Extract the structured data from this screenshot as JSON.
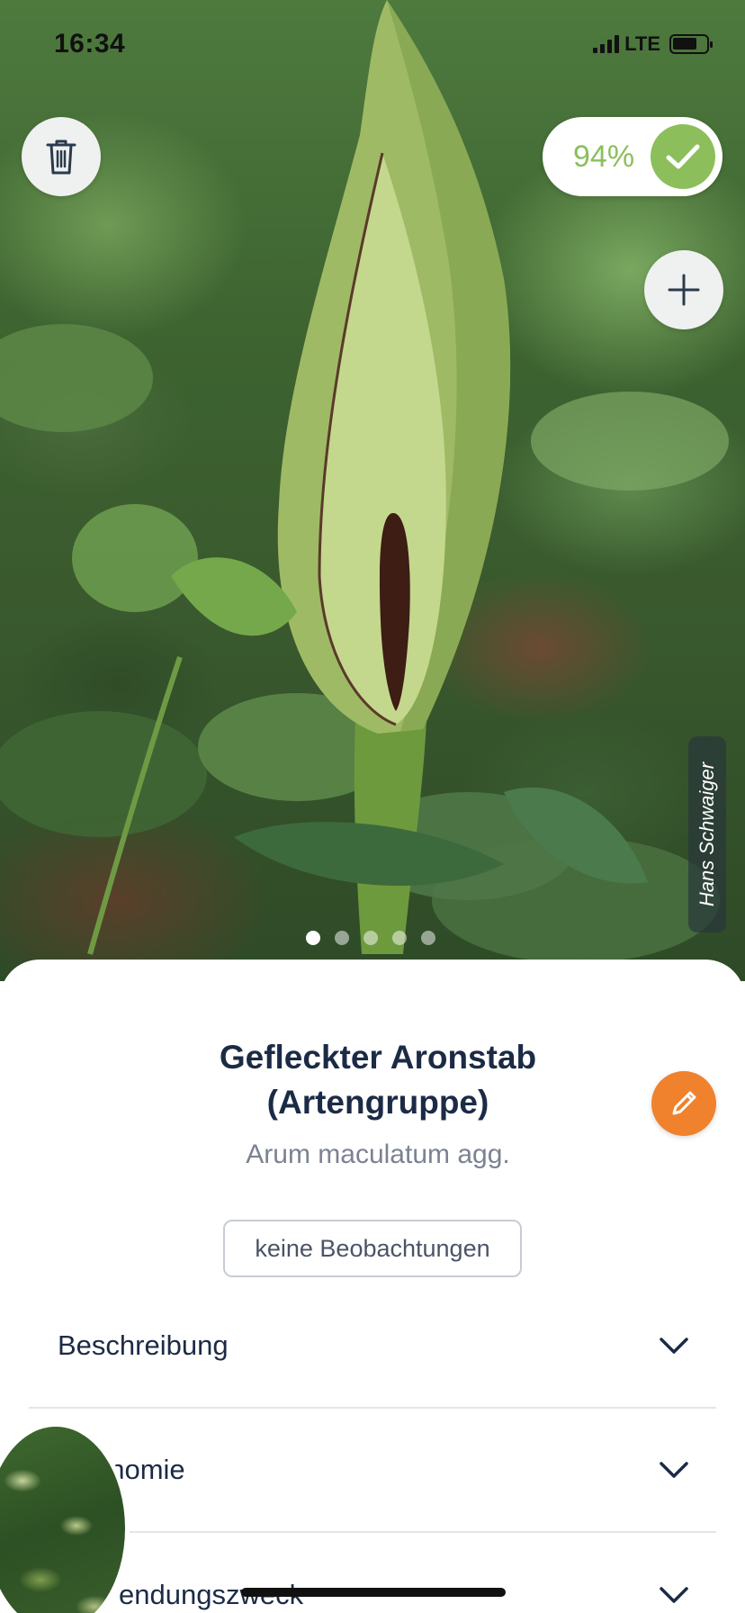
{
  "status_bar": {
    "time": "16:34",
    "network": "LTE"
  },
  "photo": {
    "confidence": "94%",
    "photographer": "Hans Schwaiger",
    "dots_total": 5,
    "dots_active_index": 0
  },
  "icons": {
    "delete": "trash-icon",
    "confidence": "check-icon",
    "add": "plus-icon",
    "edit": "pencil-icon",
    "expand": "chevron-down-icon"
  },
  "colors": {
    "accent_green": "#8cbf5c",
    "accent_orange": "#f0822d",
    "title": "#1c2b45"
  },
  "species": {
    "common_name": "Gefleckter Aronstab (Artengruppe)",
    "scientific_name": "Arum maculatum agg."
  },
  "observations_button": "keine Beobachtungen",
  "sections": [
    {
      "label": "Beschreibung"
    },
    {
      "label": "onomie"
    },
    {
      "label": "endungszweck"
    }
  ]
}
